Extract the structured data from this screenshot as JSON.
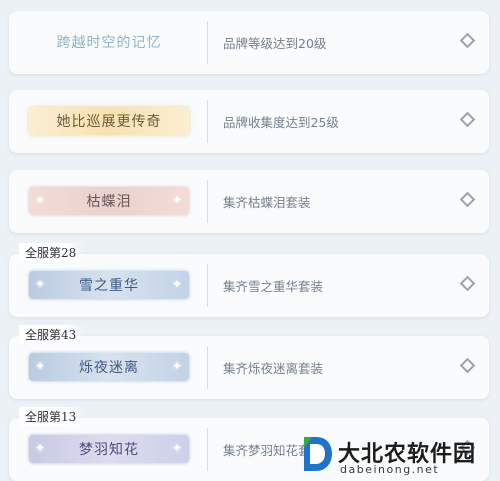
{
  "achievements": [
    {
      "title": "跨越时空的记忆",
      "requirement": "品牌等级达到20级",
      "style": "plain",
      "rank_tag": ""
    },
    {
      "title": "她比巡展更传奇",
      "requirement": "品牌收集度达到25级",
      "style": "gold",
      "rank_tag": ""
    },
    {
      "title": "枯蝶泪",
      "requirement": "集齐枯蝶泪套装",
      "style": "pink",
      "rank_tag": ""
    },
    {
      "title": "雪之重华",
      "requirement": "集齐雪之重华套装",
      "style": "blue",
      "rank_tag": "全服第28"
    },
    {
      "title": "烁夜迷离",
      "requirement": "集齐烁夜迷离套装",
      "style": "blue",
      "rank_tag": "全服第43"
    },
    {
      "title": "梦羽知花",
      "requirement": "集齐梦羽知花套装",
      "style": "lilac",
      "rank_tag": "全服第13"
    }
  ],
  "icons": {
    "status": "diamond-icon",
    "sparkle": "sparkle-icon"
  },
  "watermark": {
    "text": "大北农软件园",
    "url": "dabeinong.net"
  },
  "colors": {
    "background": "#ecf1f6",
    "card": "#f9fbfd",
    "requirement_text": "#76808d"
  }
}
